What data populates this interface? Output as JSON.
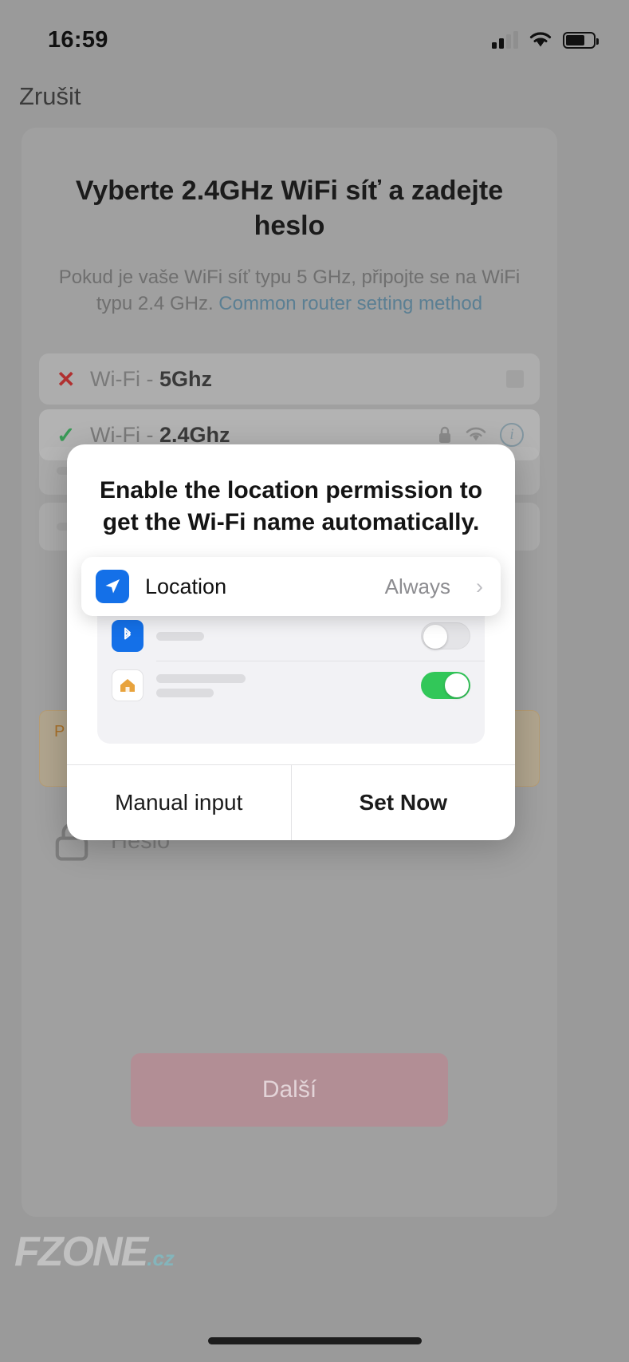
{
  "status_bar": {
    "time": "16:59",
    "cellular_icon": "cellular-signal-icon",
    "wifi_icon": "wifi-icon",
    "battery_icon": "battery-icon"
  },
  "nav": {
    "cancel_label": "Zrušit"
  },
  "card": {
    "title": "Vyberte 2.4GHz WiFi síť a zadejte heslo",
    "subtitle_text": "Pokud je vaše WiFi síť typu 5 GHz, připojte se na WiFi typu 2.4 GHz. ",
    "subtitle_link": "Common router setting method",
    "wifi_rows": [
      {
        "mark": "✕",
        "prefix": "Wi-Fi - ",
        "band": "5Ghz",
        "state": "unsupported"
      },
      {
        "mark": "✓",
        "prefix": "Wi-Fi - ",
        "band": "2.4Ghz",
        "state": "supported"
      }
    ],
    "warning_text": "P… a… P…",
    "password_placeholder": "Heslo",
    "password_value": "",
    "lock_icon": "lock-icon",
    "next_label": "Další"
  },
  "dialog": {
    "title": "Enable the location permission to get the Wi-Fi name automatically.",
    "location_row": {
      "icon": "location-arrow-icon",
      "label": "Location",
      "value": "Always",
      "chevron": "›"
    },
    "mock_rows": [
      {
        "icon": "bluetooth-icon",
        "glyph": "ᛒ",
        "toggle": "off"
      },
      {
        "icon": "home-app-icon",
        "glyph": "⌂",
        "toggle": "on"
      }
    ],
    "manual_label": "Manual input",
    "set_now_label": "Set Now"
  },
  "watermark": {
    "name": "FZONE",
    "tld": ".cz"
  },
  "colors": {
    "accent_blue": "#1470e8",
    "toggle_on_green": "#32c759",
    "error_red": "#b03030",
    "success_green": "#3a9a57",
    "link_blue": "#5b7f93",
    "warning_orange": "#a8702a"
  }
}
